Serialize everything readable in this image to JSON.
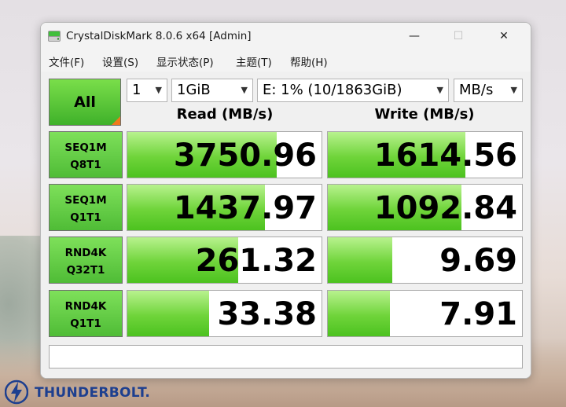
{
  "window": {
    "title": "CrystalDiskMark 8.0.6 x64 [Admin]",
    "controls": {
      "minimize": "—",
      "maximize": "☐",
      "close": "✕"
    }
  },
  "menu": [
    "文件(F)",
    "设置(S)",
    "显示状态(P)",
    "主题(T)",
    "帮助(H)"
  ],
  "toolbar": {
    "all_label": "All",
    "count": "1",
    "size": "1GiB",
    "drive": "E: 1% (10/1863GiB)",
    "unit": "MB/s"
  },
  "headers": {
    "read": "Read (MB/s)",
    "write": "Write (MB/s)"
  },
  "tests": [
    {
      "line1": "SEQ1M",
      "line2": "Q8T1",
      "read": "3750.96",
      "write": "1614.56",
      "read_fill": 0.77,
      "write_fill": 0.71
    },
    {
      "line1": "SEQ1M",
      "line2": "Q1T1",
      "read": "1437.97",
      "write": "1092.84",
      "read_fill": 0.71,
      "write_fill": 0.69
    },
    {
      "line1": "RND4K",
      "line2": "Q32T1",
      "read": "261.32",
      "write": "9.69",
      "read_fill": 0.57,
      "write_fill": 0.33
    },
    {
      "line1": "RND4K",
      "line2": "Q1T1",
      "read": "33.38",
      "write": "7.91",
      "read_fill": 0.42,
      "write_fill": 0.32
    }
  ],
  "comment": "",
  "branding": {
    "text": "THUNDERBOLT."
  },
  "colors": {
    "accent_green": "#4cc21f",
    "corner_orange": "#f07a1c",
    "thunderbolt_blue": "#1d3f8f"
  }
}
